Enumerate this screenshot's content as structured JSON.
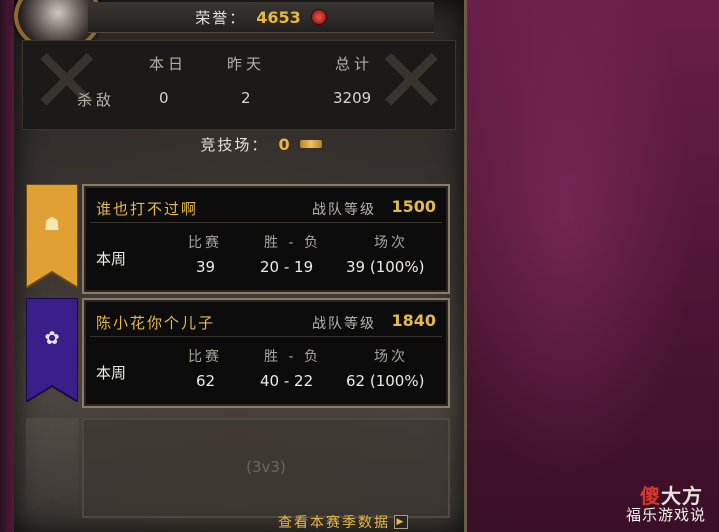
{
  "honor": {
    "label": "荣誉：",
    "value": "4653"
  },
  "stats": {
    "headers": [
      "本日",
      "昨天",
      "总计"
    ],
    "row_label": "杀敌",
    "values": [
      "0",
      "2",
      "3209"
    ]
  },
  "arena": {
    "label": "竞技场：",
    "value": "0"
  },
  "teams": [
    {
      "name": "谁也打不过啊",
      "rating_label": "战队等级",
      "rating": "1500",
      "banner_color": "#e0a033",
      "headers": [
        "比赛",
        "胜 - 负",
        "场次"
      ],
      "row_label": "本周",
      "games": "39",
      "win_loss": "20 - 19",
      "played": "39 (100%)"
    },
    {
      "name": "陈小花你个儿子",
      "rating_label": "战队等级",
      "rating": "1840",
      "banner_color": "#3a1e8a",
      "headers": [
        "比赛",
        "胜 - 负",
        "场次"
      ],
      "row_label": "本周",
      "games": "62",
      "win_loss": "40 - 22",
      "played": "62 (100%)"
    }
  ],
  "empty_slot": {
    "label": "(3v3)"
  },
  "season_link": {
    "label": "查看本赛季数据"
  },
  "watermark": {
    "line1_a": "傻",
    "line1_b": "大方",
    "line2": "福乐游戏说"
  }
}
